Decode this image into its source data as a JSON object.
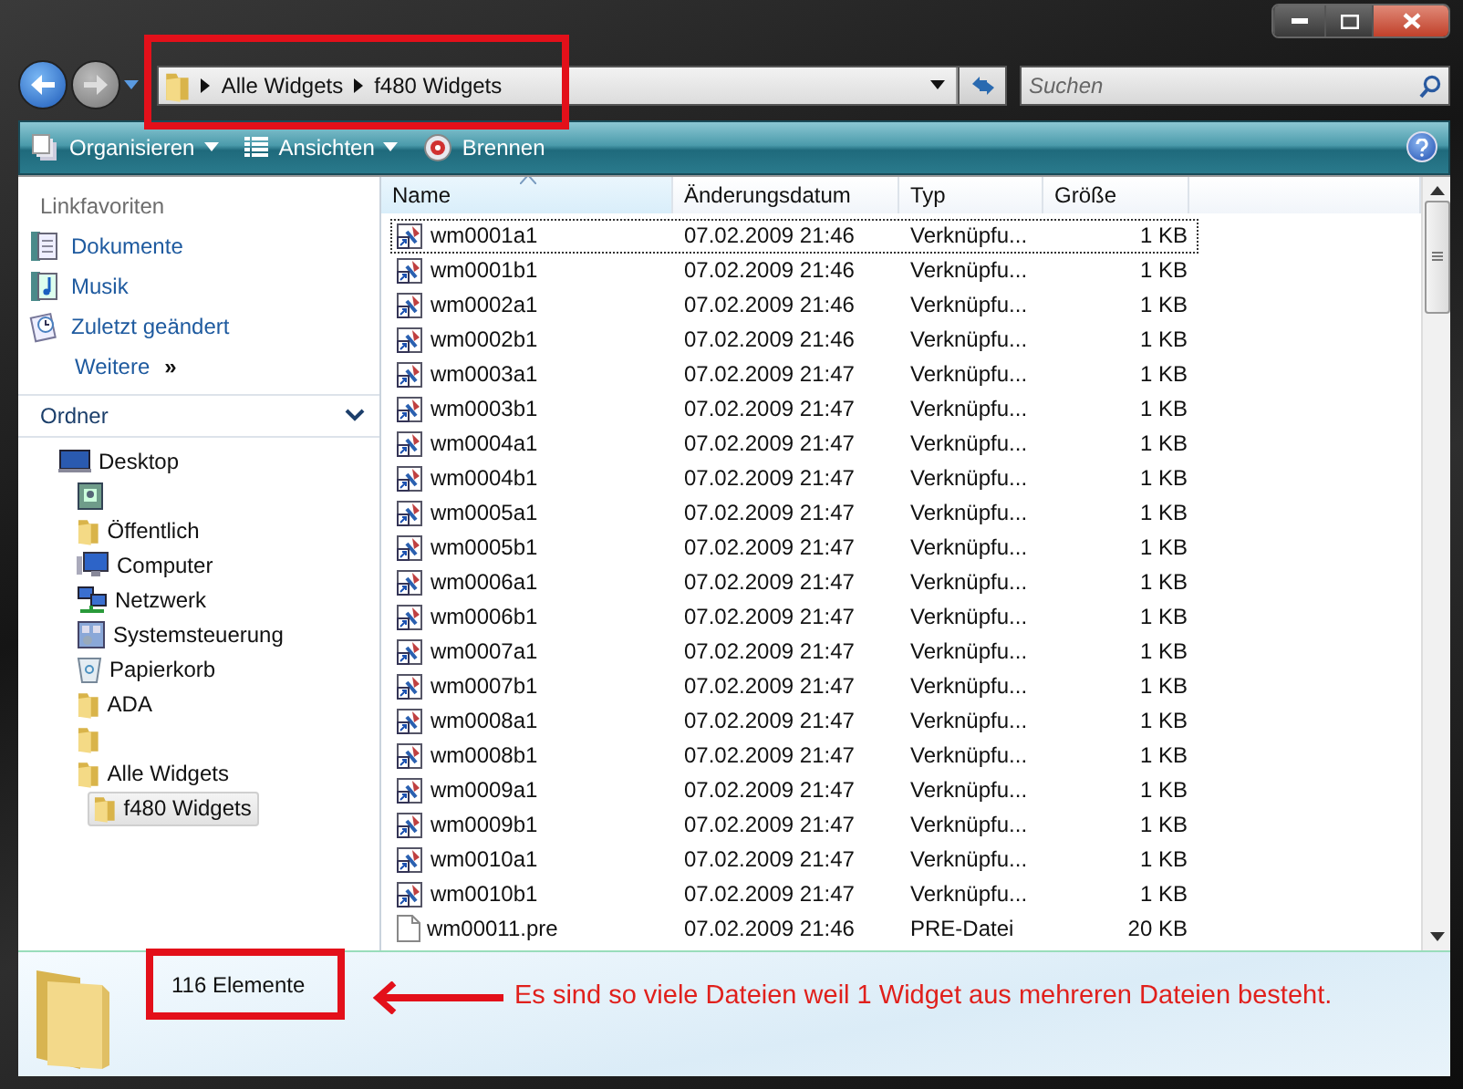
{
  "address_bar": {
    "path": [
      "Alle Widgets",
      "f480 Widgets"
    ]
  },
  "search": {
    "placeholder": "Suchen"
  },
  "toolbar": {
    "items": [
      {
        "label": "Organisieren",
        "kind": "organize",
        "has_menu": true
      },
      {
        "label": "Ansichten",
        "kind": "views",
        "has_menu": true
      },
      {
        "label": "Brennen",
        "kind": "burn",
        "has_menu": false
      }
    ]
  },
  "sidebar": {
    "title": "Linkfavoriten",
    "links": [
      {
        "label": "Dokumente",
        "kind": "documents"
      },
      {
        "label": "Musik",
        "kind": "music"
      },
      {
        "label": "Zuletzt geändert",
        "kind": "recent"
      }
    ],
    "more": {
      "label": "Weitere",
      "glyph": "»"
    }
  },
  "folders": {
    "title": "Ordner",
    "expanded": true,
    "tree": [
      {
        "label": "Desktop",
        "kind": "desktop",
        "selected": false,
        "children": [
          {
            "kind": "user",
            "selected": false
          },
          {
            "label": "Öffentlich",
            "kind": "folder",
            "selected": false
          },
          {
            "label": "Computer",
            "kind": "computer",
            "selected": false
          },
          {
            "label": "Netzwerk",
            "kind": "network",
            "selected": false
          },
          {
            "label": "Systemsteuerung",
            "kind": "control",
            "selected": false
          },
          {
            "label": "Papierkorb",
            "kind": "bin",
            "selected": false
          },
          {
            "label": "ADA",
            "kind": "folder",
            "selected": false
          },
          {
            "kind": "folder",
            "selected": false
          },
          {
            "label": "Alle Widgets",
            "kind": "folder",
            "selected": false,
            "children": [
              {
                "label": "f480 Widgets",
                "kind": "folder",
                "selected": true
              }
            ]
          }
        ]
      }
    ]
  },
  "table": {
    "columns": [
      {
        "label": "Name",
        "sorted": true
      },
      {
        "label": "Änderungsdatum",
        "sorted": false
      },
      {
        "label": "Typ",
        "sorted": false
      },
      {
        "label": "Größe",
        "sorted": false
      }
    ],
    "rows": [
      {
        "name": "wm0001a1",
        "modified": "07.02.2009 21:46",
        "type": "Verknüpfu...",
        "size": "1 KB",
        "kind": "shortcut",
        "selected": true
      },
      {
        "name": "wm0001b1",
        "modified": "07.02.2009 21:46",
        "type": "Verknüpfu...",
        "size": "1 KB",
        "kind": "shortcut",
        "selected": false
      },
      {
        "name": "wm0002a1",
        "modified": "07.02.2009 21:46",
        "type": "Verknüpfu...",
        "size": "1 KB",
        "kind": "shortcut",
        "selected": false
      },
      {
        "name": "wm0002b1",
        "modified": "07.02.2009 21:46",
        "type": "Verknüpfu...",
        "size": "1 KB",
        "kind": "shortcut",
        "selected": false
      },
      {
        "name": "wm0003a1",
        "modified": "07.02.2009 21:47",
        "type": "Verknüpfu...",
        "size": "1 KB",
        "kind": "shortcut",
        "selected": false
      },
      {
        "name": "wm0003b1",
        "modified": "07.02.2009 21:47",
        "type": "Verknüpfu...",
        "size": "1 KB",
        "kind": "shortcut",
        "selected": false
      },
      {
        "name": "wm0004a1",
        "modified": "07.02.2009 21:47",
        "type": "Verknüpfu...",
        "size": "1 KB",
        "kind": "shortcut",
        "selected": false
      },
      {
        "name": "wm0004b1",
        "modified": "07.02.2009 21:47",
        "type": "Verknüpfu...",
        "size": "1 KB",
        "kind": "shortcut",
        "selected": false
      },
      {
        "name": "wm0005a1",
        "modified": "07.02.2009 21:47",
        "type": "Verknüpfu...",
        "size": "1 KB",
        "kind": "shortcut",
        "selected": false
      },
      {
        "name": "wm0005b1",
        "modified": "07.02.2009 21:47",
        "type": "Verknüpfu...",
        "size": "1 KB",
        "kind": "shortcut",
        "selected": false
      },
      {
        "name": "wm0006a1",
        "modified": "07.02.2009 21:47",
        "type": "Verknüpfu...",
        "size": "1 KB",
        "kind": "shortcut",
        "selected": false
      },
      {
        "name": "wm0006b1",
        "modified": "07.02.2009 21:47",
        "type": "Verknüpfu...",
        "size": "1 KB",
        "kind": "shortcut",
        "selected": false
      },
      {
        "name": "wm0007a1",
        "modified": "07.02.2009 21:47",
        "type": "Verknüpfu...",
        "size": "1 KB",
        "kind": "shortcut",
        "selected": false
      },
      {
        "name": "wm0007b1",
        "modified": "07.02.2009 21:47",
        "type": "Verknüpfu...",
        "size": "1 KB",
        "kind": "shortcut",
        "selected": false
      },
      {
        "name": "wm0008a1",
        "modified": "07.02.2009 21:47",
        "type": "Verknüpfu...",
        "size": "1 KB",
        "kind": "shortcut",
        "selected": false
      },
      {
        "name": "wm0008b1",
        "modified": "07.02.2009 21:47",
        "type": "Verknüpfu...",
        "size": "1 KB",
        "kind": "shortcut",
        "selected": false
      },
      {
        "name": "wm0009a1",
        "modified": "07.02.2009 21:47",
        "type": "Verknüpfu...",
        "size": "1 KB",
        "kind": "shortcut",
        "selected": false
      },
      {
        "name": "wm0009b1",
        "modified": "07.02.2009 21:47",
        "type": "Verknüpfu...",
        "size": "1 KB",
        "kind": "shortcut",
        "selected": false
      },
      {
        "name": "wm0010a1",
        "modified": "07.02.2009 21:47",
        "type": "Verknüpfu...",
        "size": "1 KB",
        "kind": "shortcut",
        "selected": false
      },
      {
        "name": "wm0010b1",
        "modified": "07.02.2009 21:47",
        "type": "Verknüpfu...",
        "size": "1 KB",
        "kind": "shortcut",
        "selected": false
      },
      {
        "name": "wm00011.pre",
        "modified": "07.02.2009 21:46",
        "type": "PRE-Datei",
        "size": "20 KB",
        "kind": "file",
        "selected": false
      }
    ]
  },
  "status": {
    "count": "116 Elemente"
  },
  "annotation": {
    "note": "Es sind so viele Dateien weil 1 Widget aus mehreren Dateien besteht."
  }
}
